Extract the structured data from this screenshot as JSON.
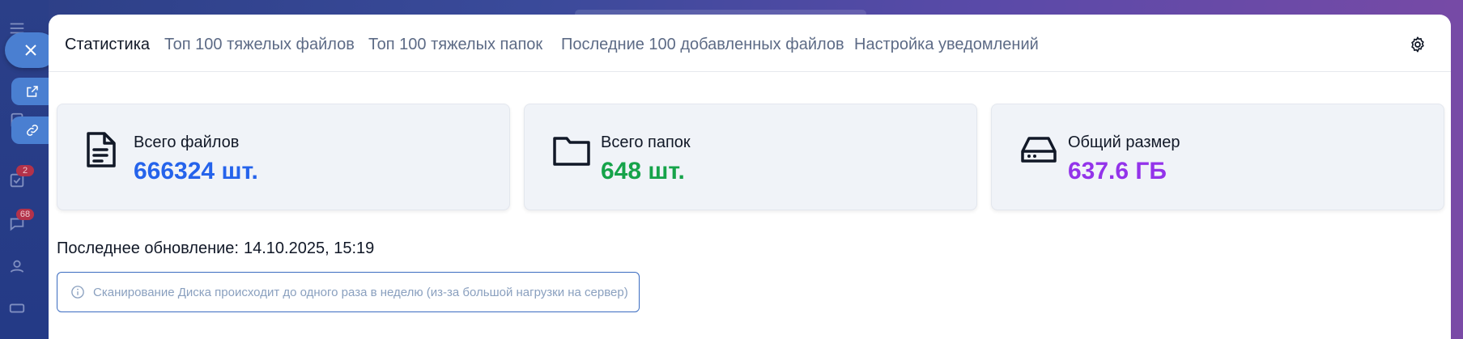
{
  "sidebar": {
    "badges": [
      "2",
      "68"
    ]
  },
  "tabs": [
    {
      "label": "Статистика",
      "active": true
    },
    {
      "label": "Топ 100 тяжелых файлов",
      "active": false
    },
    {
      "label": "Топ 100 тяжелых папок",
      "active": false
    },
    {
      "label": "Последние 100 добавленных файлов",
      "active": false
    },
    {
      "label": "Настройка уведомлений",
      "active": false
    }
  ],
  "settings_icon": "gear-icon",
  "stats": [
    {
      "label": "Всего файлов",
      "value": "666324 шт.",
      "icon": "file-icon",
      "color": "#2563eb"
    },
    {
      "label": "Всего папок",
      "value": "648 шт.",
      "icon": "folder-icon",
      "color": "#16a34a"
    },
    {
      "label": "Общий размер",
      "value": "637.6 ГБ",
      "icon": "hard-drive-icon",
      "color": "#9333ea"
    }
  ],
  "last_update": {
    "label": "Последнее обновление:",
    "value": "14.10.2025, 15:19"
  },
  "notice": {
    "icon": "info-icon",
    "text": "Сканирование Диска происходит до одного раза в неделю (из-за большой нагрузки на сервер)"
  },
  "colors": {
    "accent": "#4a7fd1",
    "tab_active": "#111827",
    "tab_inactive": "#5d6b86",
    "notice_border": "#3b6cc0"
  }
}
